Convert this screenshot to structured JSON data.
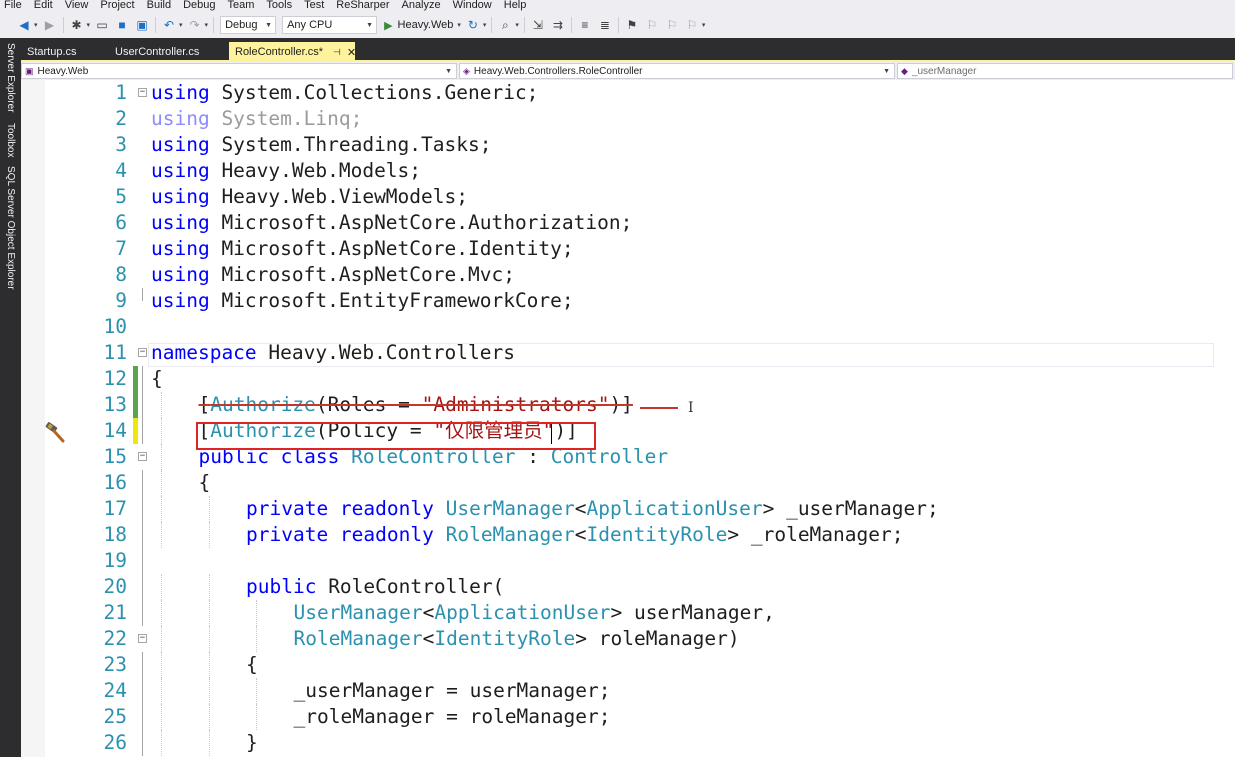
{
  "menu": [
    "File",
    "Edit",
    "View",
    "Project",
    "Build",
    "Debug",
    "Team",
    "Tools",
    "Test",
    "ReSharper",
    "Analyze",
    "Window",
    "Help"
  ],
  "toolbar": {
    "config": "Debug",
    "platform": "Any CPU",
    "run_target": "Heavy.Web"
  },
  "side_tabs": [
    "Server Explorer",
    "Toolbox",
    "SQL Server Object Explorer"
  ],
  "doc_tabs": [
    {
      "label": "Startup.cs",
      "active": false
    },
    {
      "label": "UserController.cs",
      "active": false
    },
    {
      "label": "RoleController.cs*",
      "active": true
    }
  ],
  "nav": {
    "project": "Heavy.Web",
    "type": "Heavy.Web.Controllers.RoleController",
    "member": "_userManager"
  },
  "code_lines": [
    {
      "n": "1",
      "outline": "minus",
      "segs": [
        {
          "c": "kw",
          "t": "using"
        },
        {
          "c": "",
          "t": " System.Collections.Generic;"
        }
      ]
    },
    {
      "n": "2",
      "dim": true,
      "segs": [
        {
          "c": "kw",
          "t": "using"
        },
        {
          "c": "",
          "t": " System.Linq;"
        }
      ]
    },
    {
      "n": "3",
      "segs": [
        {
          "c": "kw",
          "t": "using"
        },
        {
          "c": "",
          "t": " System.Threading.Tasks;"
        }
      ]
    },
    {
      "n": "4",
      "segs": [
        {
          "c": "kw",
          "t": "using"
        },
        {
          "c": "",
          "t": " Heavy.Web.Models;"
        }
      ]
    },
    {
      "n": "5",
      "segs": [
        {
          "c": "kw",
          "t": "using"
        },
        {
          "c": "",
          "t": " Heavy.Web.ViewModels;"
        }
      ]
    },
    {
      "n": "6",
      "segs": [
        {
          "c": "kw",
          "t": "using"
        },
        {
          "c": "",
          "t": " Microsoft.AspNetCore.Authorization;"
        }
      ]
    },
    {
      "n": "7",
      "segs": [
        {
          "c": "kw",
          "t": "using"
        },
        {
          "c": "",
          "t": " Microsoft.AspNetCore.Identity;"
        }
      ]
    },
    {
      "n": "8",
      "segs": [
        {
          "c": "kw",
          "t": "using"
        },
        {
          "c": "",
          "t": " Microsoft.AspNetCore.Mvc;"
        }
      ]
    },
    {
      "n": "9",
      "outline": "end",
      "segs": [
        {
          "c": "kw",
          "t": "using"
        },
        {
          "c": "",
          "t": " Microsoft.EntityFrameworkCore;"
        }
      ]
    },
    {
      "n": "10",
      "segs": []
    },
    {
      "n": "11",
      "outline": "minus",
      "segs": [
        {
          "c": "kw",
          "t": "namespace"
        },
        {
          "c": "",
          "t": " Heavy.Web.Controllers"
        }
      ]
    },
    {
      "n": "12",
      "change": "saved",
      "outline": "line",
      "segs": [
        {
          "c": "",
          "t": "{"
        }
      ]
    },
    {
      "n": "13",
      "change": "saved",
      "outline": "line",
      "indent": 1,
      "strike": true,
      "segs": [
        {
          "c": "",
          "t": "["
        },
        {
          "c": "ty",
          "t": "Authorize"
        },
        {
          "c": "",
          "t": "(Roles = "
        },
        {
          "c": "st",
          "t": "\"Administrators\""
        },
        {
          "c": "",
          "t": ")]"
        }
      ]
    },
    {
      "n": "14",
      "change": "unsaved",
      "outline": "line",
      "indent": 1,
      "segs": [
        {
          "c": "",
          "t": "["
        },
        {
          "c": "ty",
          "t": "Authorize"
        },
        {
          "c": "",
          "t": "(Policy = "
        },
        {
          "c": "st",
          "t": "\"仅限管理员\""
        },
        {
          "c": "",
          "t": ")]"
        }
      ]
    },
    {
      "n": "15",
      "outline": "minus",
      "indent": 1,
      "segs": [
        {
          "c": "kw",
          "t": "public class"
        },
        {
          "c": "",
          "t": " "
        },
        {
          "c": "ty",
          "t": "RoleController"
        },
        {
          "c": "",
          "t": " : "
        },
        {
          "c": "ty",
          "t": "Controller"
        }
      ]
    },
    {
      "n": "16",
      "outline": "line",
      "indent": 1,
      "segs": [
        {
          "c": "",
          "t": "{"
        }
      ]
    },
    {
      "n": "17",
      "outline": "line",
      "indent": 2,
      "segs": [
        {
          "c": "kw",
          "t": "private readonly"
        },
        {
          "c": "",
          "t": " "
        },
        {
          "c": "ty",
          "t": "UserManager"
        },
        {
          "c": "",
          "t": "<"
        },
        {
          "c": "ty",
          "t": "ApplicationUser"
        },
        {
          "c": "",
          "t": "> _userManager;"
        }
      ]
    },
    {
      "n": "18",
      "outline": "line",
      "indent": 2,
      "segs": [
        {
          "c": "kw",
          "t": "private readonly"
        },
        {
          "c": "",
          "t": " "
        },
        {
          "c": "ty",
          "t": "RoleManager"
        },
        {
          "c": "",
          "t": "<"
        },
        {
          "c": "ty",
          "t": "IdentityRole"
        },
        {
          "c": "",
          "t": "> _roleManager;"
        }
      ]
    },
    {
      "n": "19",
      "outline": "line",
      "segs": []
    },
    {
      "n": "20",
      "outline": "line",
      "indent": 2,
      "segs": [
        {
          "c": "kw",
          "t": "public"
        },
        {
          "c": "",
          "t": " RoleController("
        }
      ]
    },
    {
      "n": "21",
      "outline": "line",
      "indent": 3,
      "segs": [
        {
          "c": "ty",
          "t": "UserManager"
        },
        {
          "c": "",
          "t": "<"
        },
        {
          "c": "ty",
          "t": "ApplicationUser"
        },
        {
          "c": "",
          "t": "> userManager,"
        }
      ]
    },
    {
      "n": "22",
      "outline": "minus",
      "indent": 3,
      "segs": [
        {
          "c": "ty",
          "t": "RoleManager"
        },
        {
          "c": "",
          "t": "<"
        },
        {
          "c": "ty",
          "t": "IdentityRole"
        },
        {
          "c": "",
          "t": "> roleManager)"
        }
      ]
    },
    {
      "n": "23",
      "outline": "line",
      "indent": 2,
      "segs": [
        {
          "c": "",
          "t": "{"
        }
      ]
    },
    {
      "n": "24",
      "outline": "line",
      "indent": 3,
      "segs": [
        {
          "c": "",
          "t": "_userManager = userManager;"
        }
      ]
    },
    {
      "n": "25",
      "outline": "line",
      "indent": 3,
      "segs": [
        {
          "c": "",
          "t": "_roleManager = roleManager;"
        }
      ]
    },
    {
      "n": "26",
      "outline": "line",
      "indent": 2,
      "segs": [
        {
          "c": "",
          "t": "}"
        }
      ]
    }
  ],
  "colors": {
    "keyword": "#0000ff",
    "type": "#2b91af",
    "string": "#a31515",
    "line_number": "#2b91af",
    "change_saved": "#57a64a",
    "change_unsaved": "#efe70a",
    "highlight_box": "#e02424",
    "tab_active": "#fff29d",
    "chrome_dark": "#2d2d30"
  }
}
